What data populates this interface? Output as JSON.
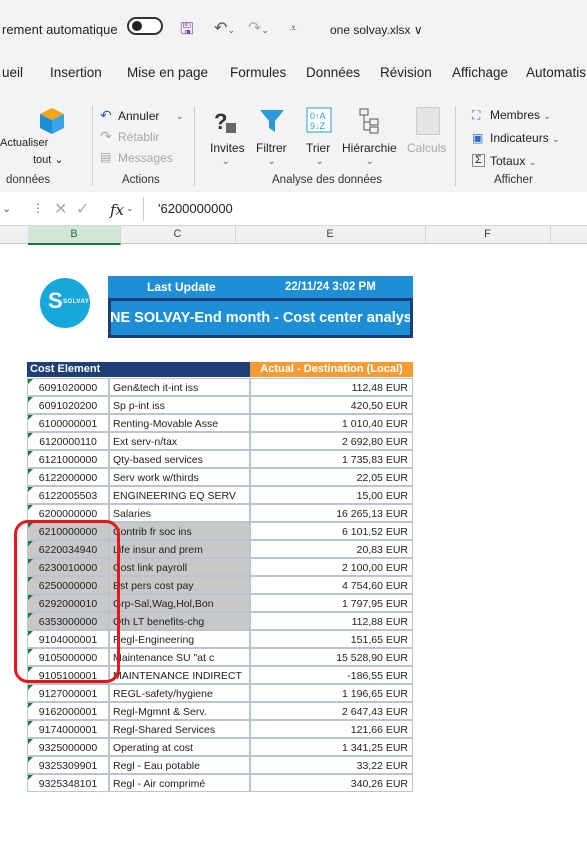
{
  "titlebar": {
    "autosave_label": "rement automatique",
    "filename": "one solvay.xlsx",
    "filename_chevron": "∨"
  },
  "menu": [
    "ueil",
    "Insertion",
    "Mise en page",
    "Formules",
    "Données",
    "Révision",
    "Affichage",
    "Automatis"
  ],
  "ribbon": {
    "actualiser": [
      "Actualiser",
      "tout ⌄"
    ],
    "annuler": "Annuler",
    "retablir": "Rétablir",
    "messages": "Messages",
    "invites": "Invites",
    "filtrer": "Filtrer",
    "trier": "Trier",
    "hierarchie": "Hiérarchie",
    "calculs": "Calculs",
    "membres": "Membres",
    "indicateurs": "Indicateurs",
    "totaux": "Totaux",
    "groups": {
      "donnees": "données",
      "actions": "Actions",
      "analyse": "Analyse des données",
      "afficher": "Afficher"
    }
  },
  "formula_bar": {
    "fx_label": "fx",
    "value": "'6200000000"
  },
  "columns": [
    "B",
    "C",
    "E",
    "F"
  ],
  "sheet": {
    "logo_text": "S",
    "logo_sub": "SOLVAY",
    "last_update_label": "Last Update",
    "last_update_value": "22/11/24 3:02 PM",
    "report_title": "NE SOLVAY-End month - Cost center analys",
    "col_header_1": "Cost Element",
    "col_header_2": "Actual  - Destination (Local)",
    "rows": [
      {
        "code": "6091020000",
        "desc": "Gen&tech it-int iss",
        "amount": "112,48 EUR"
      },
      {
        "code": "6091020200",
        "desc": "Sp p-int iss",
        "amount": "420,50 EUR"
      },
      {
        "code": "6100000001",
        "desc": "Renting-Movable Asse",
        "amount": "1 010,40 EUR"
      },
      {
        "code": "6120000110",
        "desc": "Ext serv-n/tax",
        "amount": "2 692,80 EUR"
      },
      {
        "code": "6121000000",
        "desc": "Qty-based services",
        "amount": "1 735,83 EUR"
      },
      {
        "code": "6122000000",
        "desc": "Serv work w/thirds",
        "amount": "22,05 EUR"
      },
      {
        "code": "6122005503",
        "desc": "ENGINEERING EQ SERV",
        "amount": "15,00 EUR"
      },
      {
        "code": "6200000000",
        "desc": "Salaries",
        "amount": "16 265,13 EUR"
      },
      {
        "code": "6210000000",
        "desc": "Contrib fr soc ins",
        "amount": "6 101,52 EUR"
      },
      {
        "code": "6220034940",
        "desc": "Life insur and prem",
        "amount": "20,83 EUR"
      },
      {
        "code": "6230010000",
        "desc": "Cost link payroll",
        "amount": "2 100,00 EUR"
      },
      {
        "code": "6250000000",
        "desc": "Est pers cost pay",
        "amount": "4 754,60 EUR"
      },
      {
        "code": "6292000010",
        "desc": "Grp-Sal,Wag,Hol,Bon",
        "amount": "1 797,95 EUR"
      },
      {
        "code": "6353000000",
        "desc": "Oth LT benefits-chg",
        "amount": "112,88 EUR"
      },
      {
        "code": "9104000001",
        "desc": "Regl-Engineering",
        "amount": "151,65 EUR"
      },
      {
        "code": "9105000000",
        "desc": "Maintenance SU \"at c",
        "amount": "15 528,90 EUR"
      },
      {
        "code": "9105100001",
        "desc": "MAINTENANCE INDIRECT",
        "amount": "-186,55 EUR"
      },
      {
        "code": "9127000001",
        "desc": "REGL-safety/hygiene",
        "amount": "1 196,65 EUR"
      },
      {
        "code": "9162000001",
        "desc": "Regl-Mgmnt & Serv.",
        "amount": "2 647,43 EUR"
      },
      {
        "code": "9174000001",
        "desc": "Regl-Shared Services",
        "amount": "121,66 EUR"
      },
      {
        "code": "9325000000",
        "desc": "Operating at cost",
        "amount": "1 341,25 EUR"
      },
      {
        "code": "9325309901",
        "desc": "Regl - Eau potable",
        "amount": "33,22 EUR"
      },
      {
        "code": "9325348101",
        "desc": "Regl - Air comprimé",
        "amount": "340,26 EUR"
      }
    ]
  },
  "colors": {
    "header_blue": "#1e8fd6",
    "header_navy": "#1f3e79",
    "header_orange": "#f39c34",
    "highlight_red": "#e8161b",
    "selection_gray": "#c8c8c8"
  }
}
